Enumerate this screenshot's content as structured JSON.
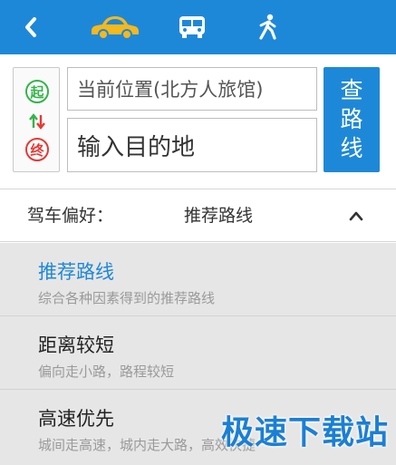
{
  "topbar": {
    "color": "#1e88d8",
    "back_icon": "chevron-left-icon",
    "modes": [
      {
        "icon": "car-icon",
        "active": true,
        "color": "#f5b81d"
      },
      {
        "icon": "bus-icon",
        "active": false
      },
      {
        "icon": "walk-icon",
        "active": false
      }
    ]
  },
  "search": {
    "start_badge": "起",
    "end_badge": "终",
    "start_value": "当前位置(北方人旅馆)",
    "destination_placeholder": "输入目的地",
    "button_label_lines": [
      "查",
      "路",
      "线"
    ]
  },
  "preference": {
    "label": "驾车偏好：",
    "value": "推荐路线"
  },
  "options": [
    {
      "title": "推荐路线",
      "subtitle": "综合各种因素得到的推荐路线",
      "selected": true
    },
    {
      "title": "距离较短",
      "subtitle": "偏向走小路，路程较短",
      "selected": false
    },
    {
      "title": "高速优先",
      "subtitle": "城间走高速，城内走大路，高效快捷",
      "selected": false
    }
  ],
  "watermark": "极速下载站"
}
